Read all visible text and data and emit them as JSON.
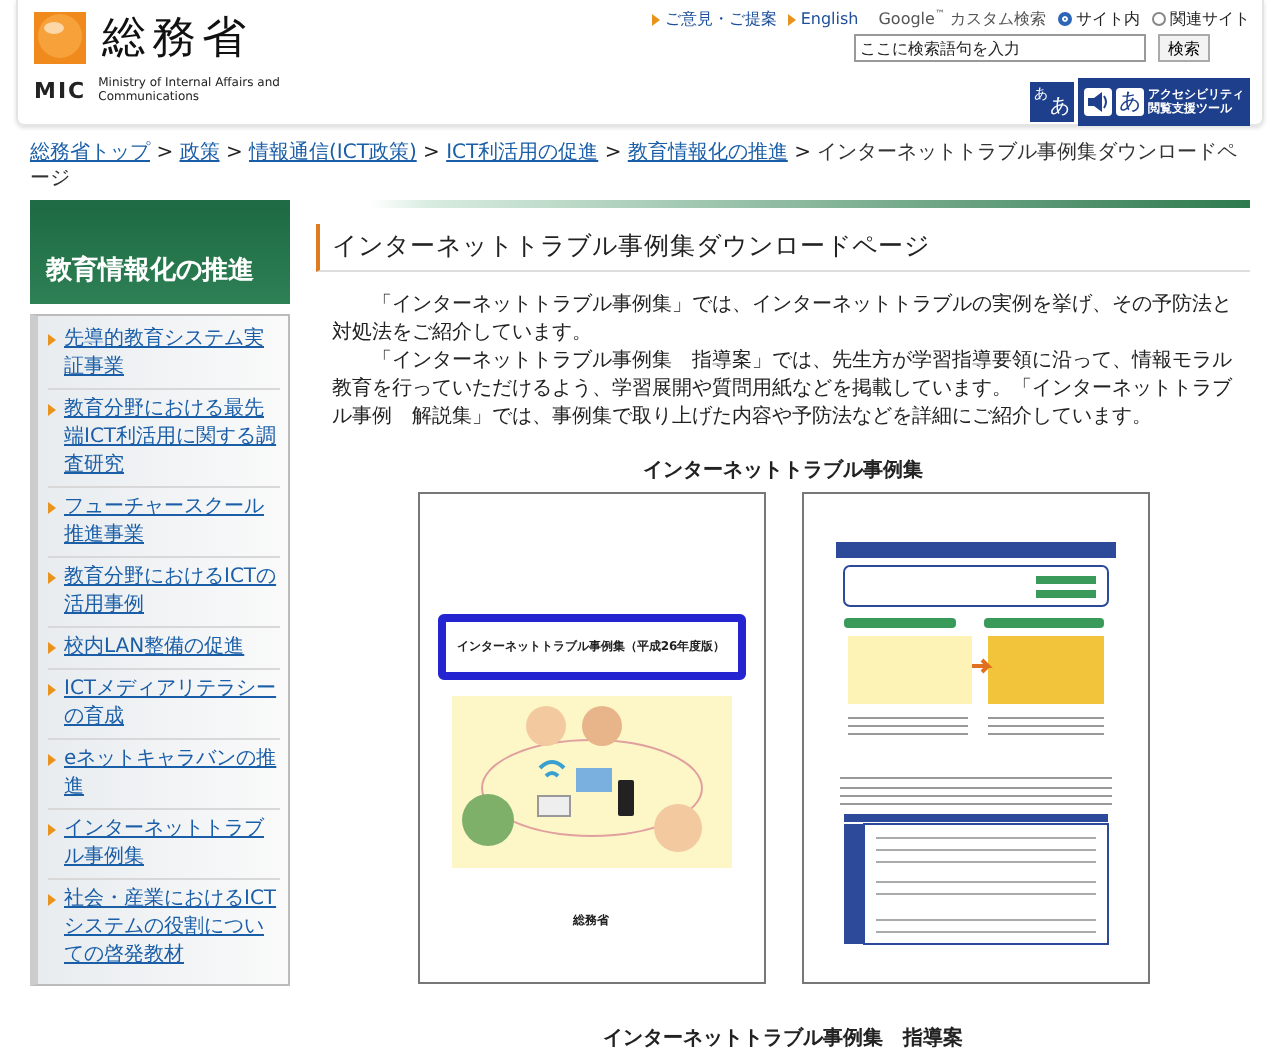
{
  "header": {
    "logo_title": "総務省",
    "logo_abbr": "MIC",
    "logo_subtitle": "Ministry of Internal Affairs and Communications",
    "links": [
      "ご意見・ご提案",
      "English"
    ],
    "search": {
      "label": "Google$^{™}$ カスタム検索",
      "scopes": [
        {
          "label": "サイト内",
          "selected": true
        },
        {
          "label": "関連サイト",
          "selected": false
        }
      ],
      "placeholder": "ここに検索語句を入力",
      "button": "検索"
    },
    "text_size_glyphs": [
      "あ",
      "あ"
    ],
    "hiragana_glyph": "あ",
    "accessibility_button": [
      "アクセシビリティ",
      "閲覧支援ツール"
    ]
  },
  "breadcrumb": {
    "separator": ">",
    "items": [
      {
        "label": "総務省トップ",
        "link": true
      },
      {
        "label": "政策",
        "link": true
      },
      {
        "label": "情報通信(ICT政策)",
        "link": true
      },
      {
        "label": "ICT利活用の促進",
        "link": true
      },
      {
        "label": "教育情報化の推進",
        "link": true
      },
      {
        "label": "インターネットトラブル事例集ダウンロードページ",
        "link": false
      }
    ]
  },
  "sidebar": {
    "title": "教育情報化の推進",
    "items": [
      "先導的教育システム実証事業",
      "教育分野における最先端ICT利活用に関する調査研究",
      "フューチャースクール推進事業",
      "教育分野におけるICTの活用事例",
      "校内LAN整備の促進",
      "ICTメディアリテラシーの育成",
      "eネットキャラバンの推進",
      "インターネットトラブル事例集",
      "社会・産業におけるICTシステムの役割についての啓発教材"
    ]
  },
  "main": {
    "heading": "インターネットトラブル事例集ダウンロードページ",
    "paragraphs": [
      "「インターネットトラブル事例集」では、インターネットトラブルの実例を挙げ、その予防法と対処法をご紹介しています。",
      "「インターネットトラブル事例集　指導案」では、先生方が学習指導要領に沿って、情報モラル教育を行っていただけるよう、学習展開や質問用紙などを掲載しています。「インターネットトラブル事例　解説集」では、事例集で取り上げた内容や予防法などを詳細にご紹介しています。"
    ],
    "figures": [
      {
        "caption": "インターネットトラブル事例集",
        "pages": [
          {
            "kind": "cover",
            "title": "インターネットトラブル事例集（平成26年度版）",
            "publisher": "総務省"
          },
          {
            "kind": "content"
          }
        ]
      },
      {
        "caption": "インターネットトラブル事例集　指導案"
      }
    ]
  }
}
